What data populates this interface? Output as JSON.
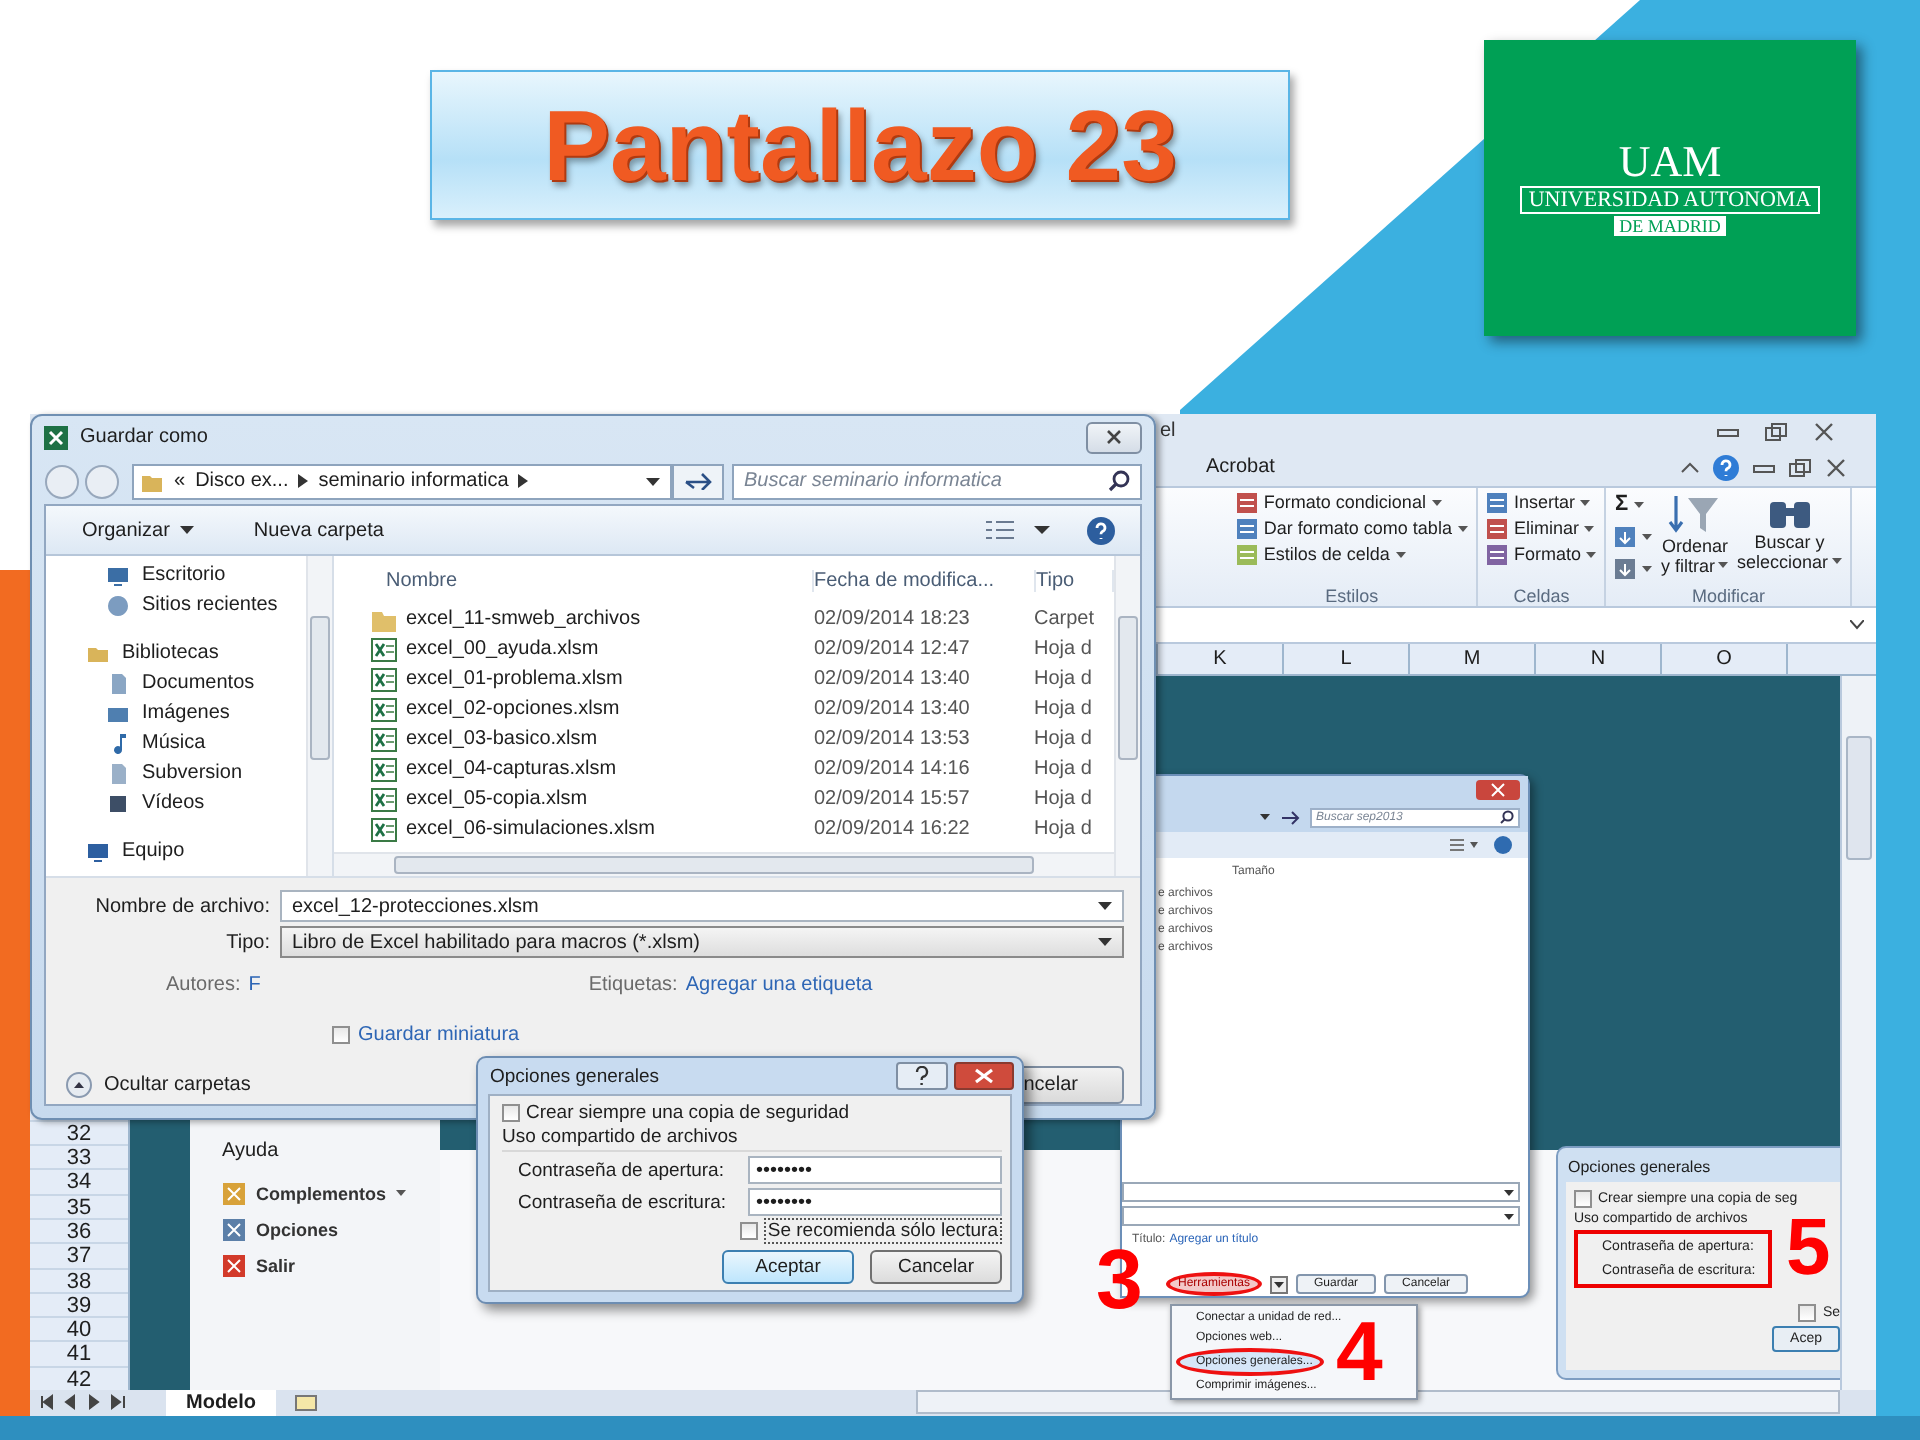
{
  "slide": {
    "title": "Pantallazo 23",
    "logo": {
      "initials": "UAM",
      "name": "UNIVERSIDAD AUTONOMA",
      "city": "DE MADRID"
    }
  },
  "excel": {
    "title": "el",
    "tab": "Acrobat",
    "ribbon_groups": [
      {
        "kind": "list",
        "label": "Estilos",
        "items": [
          {
            "kind": "conditional",
            "label": "Formato condicional"
          },
          {
            "kind": "table",
            "label": "Dar formato como tabla"
          },
          {
            "kind": "cellstyle",
            "label": "Estilos de celda"
          }
        ]
      },
      {
        "kind": "list",
        "label": "Celdas",
        "items": [
          {
            "kind": "insert",
            "label": "Insertar"
          },
          {
            "kind": "delete",
            "label": "Eliminar"
          },
          {
            "kind": "format",
            "label": "Formato"
          }
        ]
      },
      {
        "kind": "editing",
        "label": "Modificar",
        "small": [
          {
            "kind": "sum",
            "label": "Σ"
          },
          {
            "kind": "fill"
          },
          {
            "kind": "clear"
          }
        ],
        "large": [
          {
            "kind": "sort",
            "lines": [
              "Ordenar",
              "y filtrar"
            ]
          },
          {
            "kind": "find",
            "lines": [
              "Buscar y",
              "seleccionar"
            ]
          }
        ]
      }
    ],
    "columns": [
      "K",
      "L",
      "M",
      "N",
      "O"
    ],
    "rows": [
      "32",
      "33",
      "34",
      "35",
      "36",
      "37",
      "38",
      "39",
      "40",
      "41",
      "42"
    ],
    "backstage": {
      "heading": "Ayuda",
      "items": [
        {
          "kind": "addins",
          "label": "Complementos",
          "dropdown": true
        },
        {
          "kind": "options",
          "label": "Opciones",
          "dropdown": false
        },
        {
          "kind": "exit",
          "label": "Salir",
          "dropdown": false
        }
      ]
    },
    "sheets": [
      {
        "label": "Modelo",
        "selected": true
      }
    ]
  },
  "save_dialog": {
    "title": "Guardar como",
    "path_overflow": "«",
    "path": [
      "Disco ex...",
      "seminario informatica"
    ],
    "search_placeholder": "Buscar seminario informatica",
    "toolbar": [
      {
        "label": "Organizar",
        "dropdown": true
      },
      {
        "label": "Nueva carpeta",
        "dropdown": false
      }
    ],
    "nav": [
      {
        "children": [
          {
            "kind": "desktop",
            "label": "Escritorio"
          },
          {
            "kind": "recent",
            "label": "Sitios recientes"
          }
        ]
      },
      {
        "kind": "library",
        "label": "Bibliotecas",
        "children": [
          {
            "kind": "documents",
            "label": "Documentos"
          },
          {
            "kind": "pictures",
            "label": "Imágenes"
          },
          {
            "kind": "music",
            "label": "Música"
          },
          {
            "kind": "svn",
            "label": "Subversion"
          },
          {
            "kind": "videos",
            "label": "Vídeos"
          }
        ]
      },
      {
        "kind": "computer",
        "label": "Equipo"
      }
    ],
    "columns": [
      "Nombre",
      "Fecha de modifica...",
      "Tipo"
    ],
    "files": [
      {
        "kind": "folder",
        "name": "excel_11-smweb_archivos",
        "date": "02/09/2014 18:23",
        "type": "Carpet"
      },
      {
        "kind": "workbook",
        "name": "excel_00_ayuda.xlsm",
        "date": "02/09/2014 12:47",
        "type": "Hoja d"
      },
      {
        "kind": "workbook",
        "name": "excel_01-problema.xlsm",
        "date": "02/09/2014 13:40",
        "type": "Hoja d"
      },
      {
        "kind": "workbook",
        "name": "excel_02-opciones.xlsm",
        "date": "02/09/2014 13:40",
        "type": "Hoja d"
      },
      {
        "kind": "workbook",
        "name": "excel_03-basico.xlsm",
        "date": "02/09/2014 13:53",
        "type": "Hoja d"
      },
      {
        "kind": "workbook",
        "name": "excel_04-capturas.xlsm",
        "date": "02/09/2014 14:16",
        "type": "Hoja d"
      },
      {
        "kind": "workbook",
        "name": "excel_05-copia.xlsm",
        "date": "02/09/2014 15:57",
        "type": "Hoja d"
      },
      {
        "kind": "workbook",
        "name": "excel_06-simulaciones.xlsm",
        "date": "02/09/2014 16:22",
        "type": "Hoja d"
      }
    ],
    "filename_label": "Nombre de archivo:",
    "filename": "excel_12-protecciones.xlsm",
    "type_label": "Tipo:",
    "type_value": "Libro de Excel habilitado para macros (*.xlsm)",
    "authors_label": "Autores:",
    "authors": "F",
    "tags_label": "Etiquetas:",
    "tags": "Agregar una etiqueta",
    "thumbnail": {
      "label": "Guardar miniatura",
      "checked": false
    },
    "hide_folders": "Ocultar carpetas",
    "cancel": "ncelar"
  },
  "inner_dialog": {
    "search_placeholder": "Buscar sep2013",
    "column": "Tamaño",
    "rows": [
      "e archivos",
      "e archivos",
      "e archivos",
      "e archivos"
    ],
    "title_label": "Título:",
    "title_link": "Agregar un título",
    "tools": "Herramientas",
    "save": "Guardar",
    "cancel": "Cancelar",
    "menu": [
      {
        "label": "Conectar a unidad de red...",
        "selected": false
      },
      {
        "label": "Opciones web...",
        "selected": false
      },
      {
        "label": "Opciones generales...",
        "selected": true
      },
      {
        "label": "Comprimir imágenes...",
        "selected": false
      }
    ],
    "step_tools": "3",
    "step_menu": "4"
  },
  "options_dialog": {
    "title": "Opciones generales",
    "backup": {
      "label": "Crear siempre una copia de seguridad",
      "checked": false
    },
    "section": "Uso compartido de archivos",
    "fields": [
      {
        "label": "Contraseña de apertura:",
        "value": "••••••••"
      },
      {
        "label": "Contraseña de escritura:",
        "value": "••••••••"
      }
    ],
    "readonly": {
      "label": "Se recomienda sólo lectura",
      "checked": false
    },
    "buttons": [
      "Aceptar",
      "Cancelar"
    ]
  },
  "right_dialog": {
    "title": "Opciones generales",
    "backup": {
      "label": "Crear siempre una copia de seg",
      "checked": false
    },
    "section": "Uso compartido de archivos",
    "fields": [
      "Contraseña de apertura:",
      "Contraseña de escritura:"
    ],
    "readonly": {
      "label": "Se",
      "checked": false
    },
    "button": "Acep",
    "step": "5"
  }
}
